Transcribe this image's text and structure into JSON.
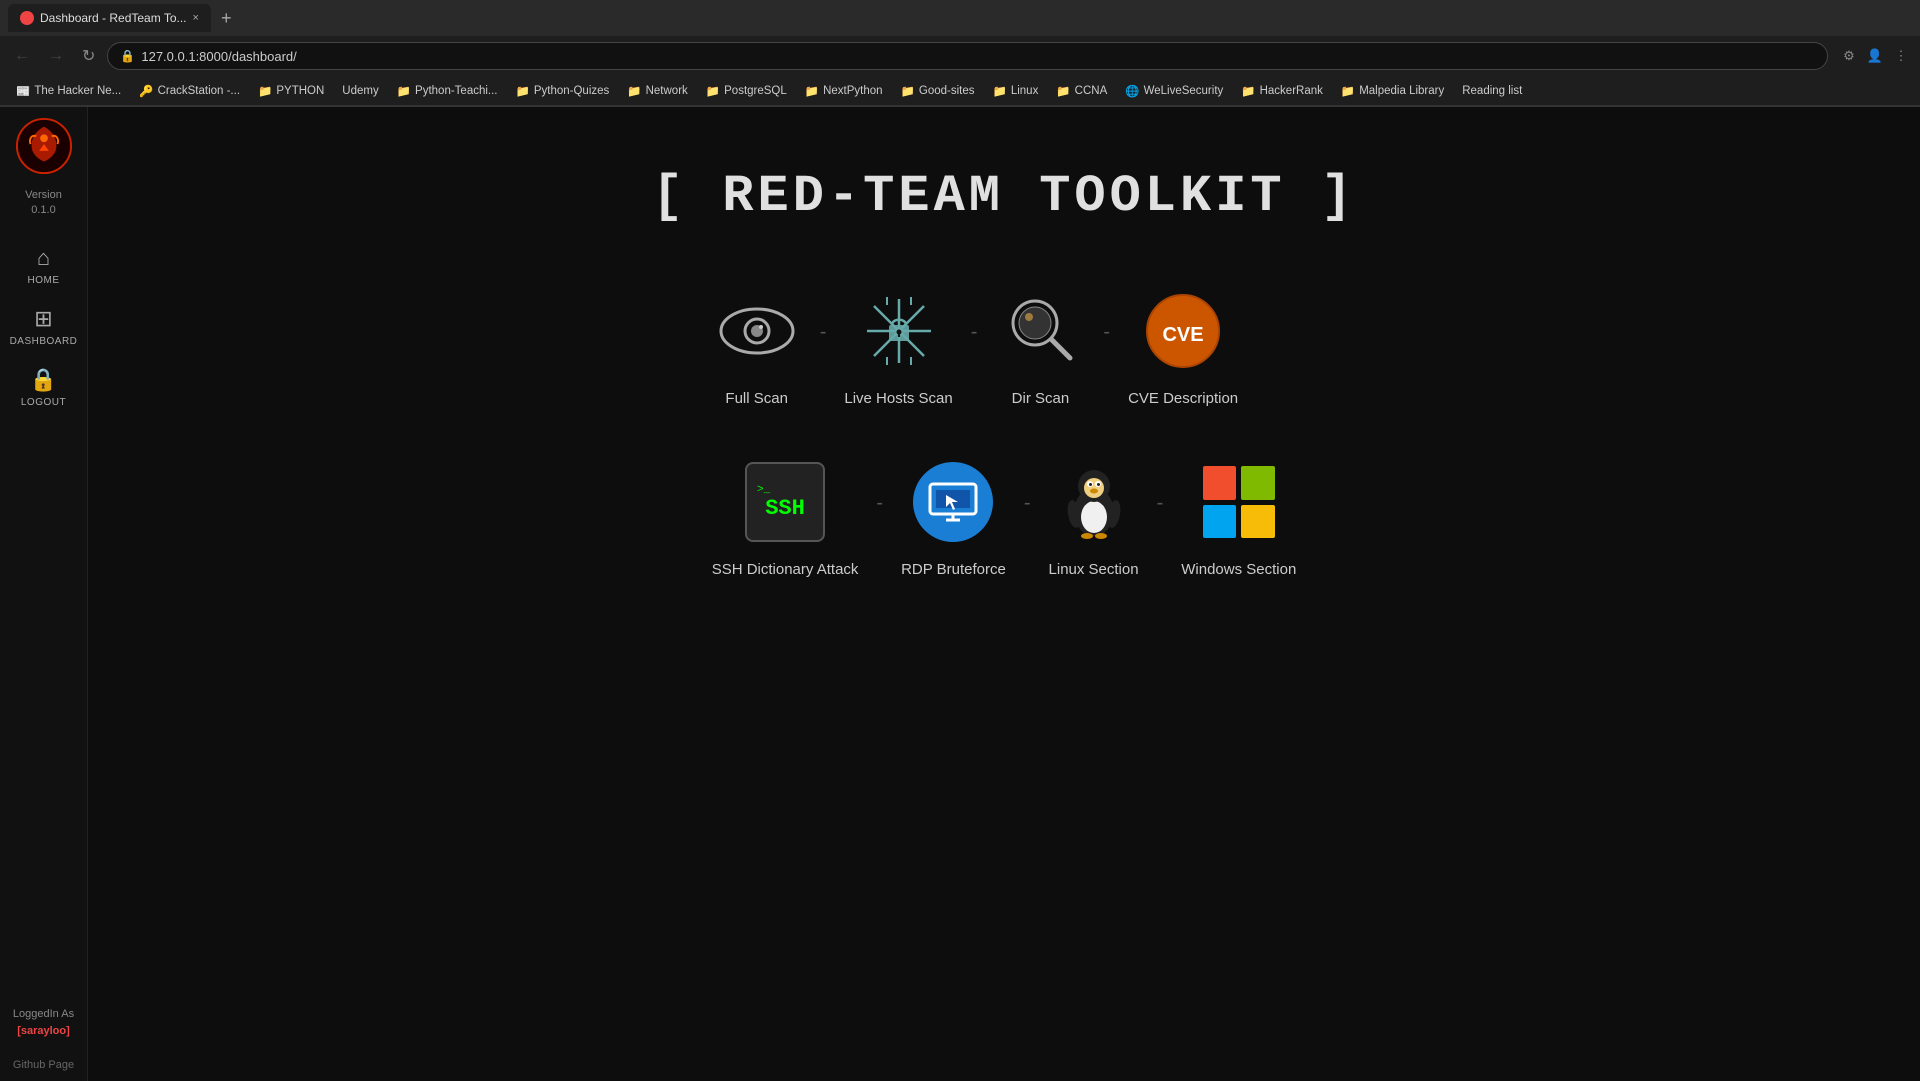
{
  "browser": {
    "tab_title": "Dashboard - RedTeam To...",
    "tab_close": "×",
    "tab_new": "+",
    "url": "127.0.0.1:8000/dashboard/",
    "nav_back": "←",
    "nav_forward": "→",
    "nav_refresh": "↻",
    "bookmarks": [
      {
        "label": "The Hacker Ne...",
        "has_icon": true
      },
      {
        "label": "CrackStation -...",
        "has_icon": true
      },
      {
        "label": "PYTHON",
        "has_icon": true
      },
      {
        "label": "Udemy",
        "has_icon": false
      },
      {
        "label": "Python-Teachi...",
        "has_icon": true
      },
      {
        "label": "Python-Quizes",
        "has_icon": true
      },
      {
        "label": "Network",
        "has_icon": true
      },
      {
        "label": "PostgreSQL",
        "has_icon": true
      },
      {
        "label": "NextPython",
        "has_icon": true
      },
      {
        "label": "Good-sites",
        "has_icon": true
      },
      {
        "label": "Linux",
        "has_icon": true
      },
      {
        "label": "CCNA",
        "has_icon": true
      },
      {
        "label": "WeLiveSecurity",
        "has_icon": true
      },
      {
        "label": "HackerRank",
        "has_icon": true
      },
      {
        "label": "Malpedia Library",
        "has_icon": true
      },
      {
        "label": "Reading list",
        "has_icon": false
      }
    ]
  },
  "sidebar": {
    "version_label": "Version",
    "version_number": "0.1.0",
    "nav_items": [
      {
        "label": "HOME",
        "icon": "⌂"
      },
      {
        "label": "Dashboard",
        "icon": "⊞"
      },
      {
        "label": "LOGOUT",
        "icon": "🔒"
      }
    ],
    "logged_in_label": "LoggedIn As",
    "logged_in_user": "[sarayloo]",
    "github_label": "Github Page"
  },
  "main": {
    "title": "[ RED-TEAM TOOLKIT ]",
    "tools_row1": [
      {
        "id": "full-scan",
        "label": "Full Scan",
        "icon_type": "eye"
      },
      {
        "id": "live-hosts-scan",
        "label": "Live Hosts Scan",
        "icon_type": "snowflake-lock"
      },
      {
        "id": "dir-scan",
        "label": "Dir Scan",
        "icon_type": "magnifier"
      },
      {
        "id": "cve-description",
        "label": "CVE Description",
        "icon_type": "cve"
      }
    ],
    "tools_row2": [
      {
        "id": "ssh-dictionary",
        "label": "SSH Dictionary Attack",
        "icon_type": "ssh"
      },
      {
        "id": "rdp-bruteforce",
        "label": "RDP Bruteforce",
        "icon_type": "rdp"
      },
      {
        "id": "linux-section",
        "label": "Linux Section",
        "icon_type": "linux"
      },
      {
        "id": "windows-section",
        "label": "Windows Section",
        "icon_type": "windows"
      }
    ],
    "separator": "-"
  }
}
